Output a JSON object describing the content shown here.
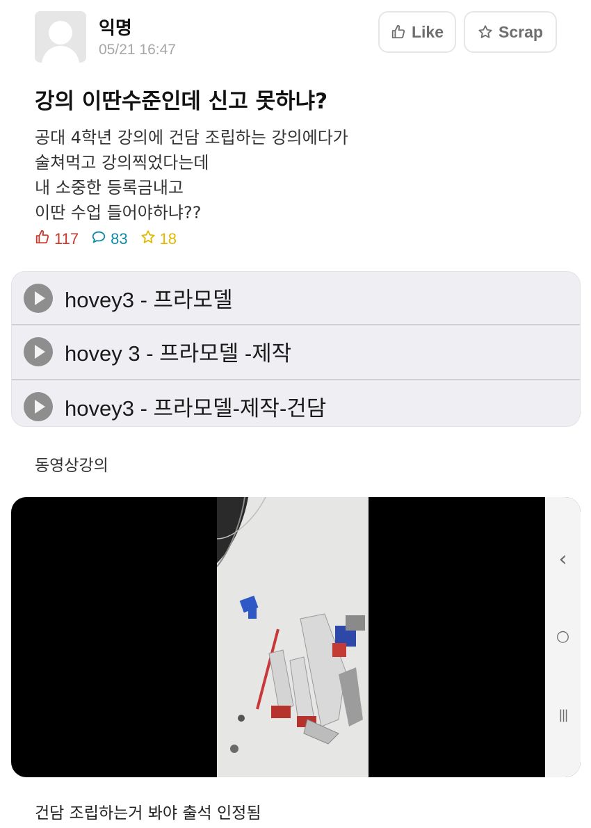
{
  "post": {
    "author": "익명",
    "timestamp": "05/21 16:47",
    "title": "강의 이딴수준인데 신고 못하냐?",
    "content": [
      "공대 4학년 강의에 건담 조립하는 강의에다가",
      "술쳐먹고 강의찍었다는데",
      "내 소중한 등록금내고",
      "이딴 수업 들어야하냐??"
    ]
  },
  "actions": {
    "like_label": "Like",
    "scrap_label": "Scrap",
    "like_icon": "thumbs-up-icon",
    "scrap_icon": "star-outline-icon"
  },
  "stats": {
    "likes": "117",
    "comments": "83",
    "scraps": "18"
  },
  "playlist": {
    "items": [
      {
        "label": "hovey3 - 프라모델"
      },
      {
        "label": "hovey 3 - 프라모델 -제작"
      },
      {
        "label": "hovey3 - 프라모델-제작-건담"
      }
    ]
  },
  "section_label": "동영상강의",
  "video": {
    "nav_back": "‹",
    "nav_home": "○",
    "nav_recent": "|||"
  },
  "caption": "건담 조립하는거 봐야 출석 인정됨",
  "colors": {
    "likes": "#c83a2b",
    "comments": "#0e8ba8",
    "scraps": "#e2b800",
    "playlist_bg": "#efeff3"
  }
}
